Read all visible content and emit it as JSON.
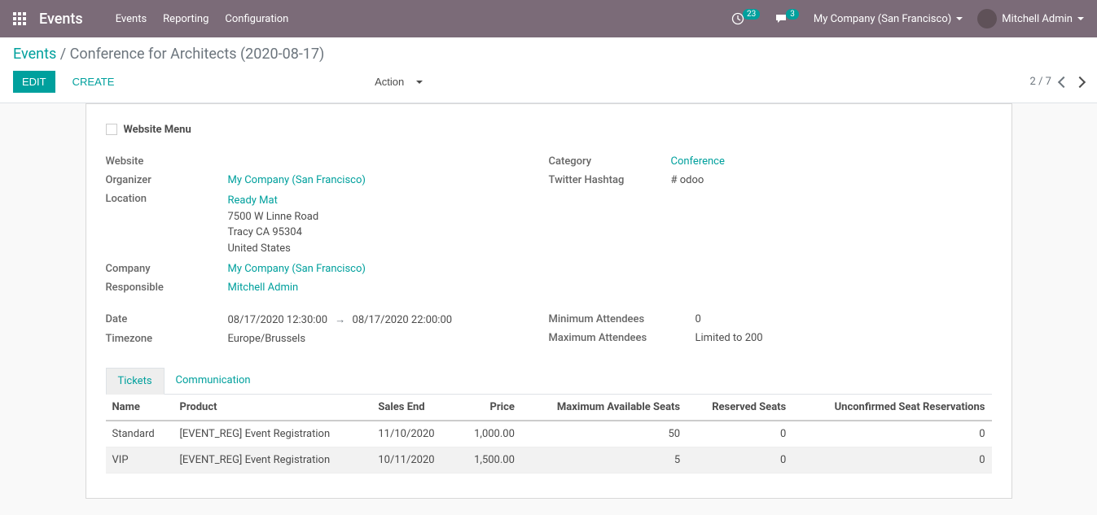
{
  "nav": {
    "brand": "Events",
    "links": [
      "Events",
      "Reporting",
      "Configuration"
    ],
    "activity_count": "23",
    "msg_count": "3",
    "company": "My Company (San Francisco)",
    "user": "Mitchell Admin"
  },
  "breadcrumb": {
    "root": "Events",
    "sep": "/",
    "current": "Conference for Architects (2020-08-17)"
  },
  "buttons": {
    "edit": "EDIT",
    "create": "CREATE",
    "action": "Action"
  },
  "pager": "2 / 7",
  "form": {
    "website_menu_label": "Website Menu",
    "labels": {
      "website": "Website",
      "organizer": "Organizer",
      "location": "Location",
      "company": "Company",
      "responsible": "Responsible",
      "date": "Date",
      "timezone": "Timezone",
      "category": "Category",
      "twitter": "Twitter Hashtag",
      "min_att": "Minimum Attendees",
      "max_att": "Maximum Attendees"
    },
    "values": {
      "website": "",
      "organizer": "My Company (San Francisco)",
      "location_name": "Ready Mat",
      "location_street": "7500 W Linne Road",
      "location_city": "Tracy CA 95304",
      "location_country": "United States",
      "company": "My Company (San Francisco)",
      "responsible": "Mitchell Admin",
      "date_start": "08/17/2020 12:30:00",
      "date_end": "08/17/2020 22:00:00",
      "timezone": "Europe/Brussels",
      "category": "Conference",
      "twitter": "# odoo",
      "min_att": "0",
      "max_att": "Limited to 200"
    }
  },
  "tabs": {
    "tickets": "Tickets",
    "communication": "Communication"
  },
  "table": {
    "headers": {
      "name": "Name",
      "product": "Product",
      "sales_end": "Sales End",
      "price": "Price",
      "max_seats": "Maximum Available Seats",
      "reserved": "Reserved Seats",
      "unconfirmed": "Unconfirmed Seat Reservations"
    },
    "rows": [
      {
        "name": "Standard",
        "product": "[EVENT_REG] Event Registration",
        "sales_end": "11/10/2020",
        "price": "1,000.00",
        "max_seats": "50",
        "reserved": "0",
        "unconfirmed": "0"
      },
      {
        "name": "VIP",
        "product": "[EVENT_REG] Event Registration",
        "sales_end": "10/11/2020",
        "price": "1,500.00",
        "max_seats": "5",
        "reserved": "0",
        "unconfirmed": "0"
      }
    ]
  }
}
